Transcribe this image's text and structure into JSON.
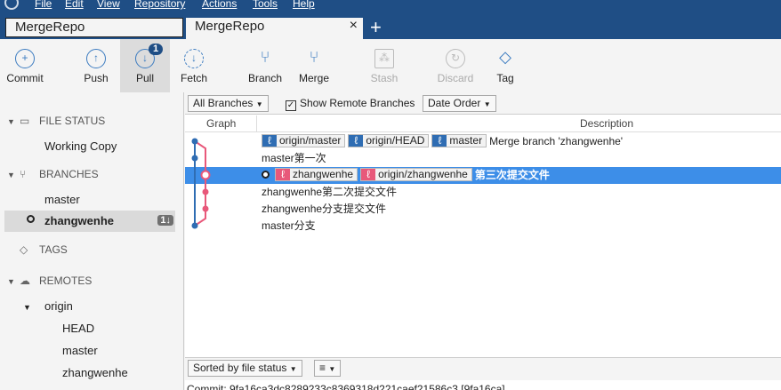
{
  "menu": [
    "File",
    "Edit",
    "View",
    "Repository",
    "Actions",
    "Tools",
    "Help"
  ],
  "tabs": [
    {
      "label": "MergeRepo"
    },
    {
      "label": "MergeRepo",
      "close": "×"
    }
  ],
  "new_tab": "+",
  "toolbar": [
    {
      "label": "Commit",
      "icon": "plus-circle-icon",
      "glyph": "+"
    },
    {
      "label": "Push",
      "icon": "arrow-up-icon",
      "glyph": "↑"
    },
    {
      "label": "Pull",
      "icon": "arrow-down-icon",
      "glyph": "↓",
      "badge": "1"
    },
    {
      "label": "Fetch",
      "icon": "fetch-icon",
      "glyph": "↓"
    },
    {
      "label": "Branch",
      "icon": "branch-icon",
      "glyph": "⑂"
    },
    {
      "label": "Merge",
      "icon": "merge-icon",
      "glyph": "⑂"
    },
    {
      "label": "Stash",
      "icon": "stash-icon",
      "glyph": "⁂"
    },
    {
      "label": "Discard",
      "icon": "discard-icon",
      "glyph": "↻"
    },
    {
      "label": "Tag",
      "icon": "tag-icon",
      "glyph": "◇"
    }
  ],
  "sidebar": {
    "file_status": "FILE STATUS",
    "working_copy": "Working Copy",
    "branches": "BRANCHES",
    "branch_items": [
      "master",
      "zhangwenhe"
    ],
    "branch_count": "1↓",
    "tags": "TAGS",
    "remotes": "REMOTES",
    "remote": "origin",
    "remote_items": [
      "HEAD",
      "master",
      "zhangwenhe"
    ]
  },
  "filter": {
    "branches": "All Branches",
    "show_remote": "Show Remote Branches",
    "order": "Date Order"
  },
  "columns": {
    "graph": "Graph",
    "description": "Description"
  },
  "commits": [
    {
      "refs": [
        "origin/master",
        "origin/HEAD",
        "master"
      ],
      "message": "Merge branch 'zhangwenhe'"
    },
    {
      "refs": [],
      "message": "master第一次"
    },
    {
      "refs": [
        "zhangwenhe",
        "origin/zhangwenhe"
      ],
      "message": "第三次提交文件"
    },
    {
      "refs": [],
      "message": "zhangwenhe第二次提交文件"
    },
    {
      "refs": [],
      "message": "zhangwenhe分支提交文件"
    },
    {
      "refs": [],
      "message": "master分支"
    }
  ],
  "colors": {
    "blue": "#2f6db3",
    "pink": "#e8587a",
    "selected": "#3d8ee8"
  },
  "bottom": {
    "sort": "Sorted by file status",
    "view": "≡"
  },
  "commit_line": "Commit: 9fa16ca3dc8289233c8369318d221caef21586c3 [9fa16ca]"
}
